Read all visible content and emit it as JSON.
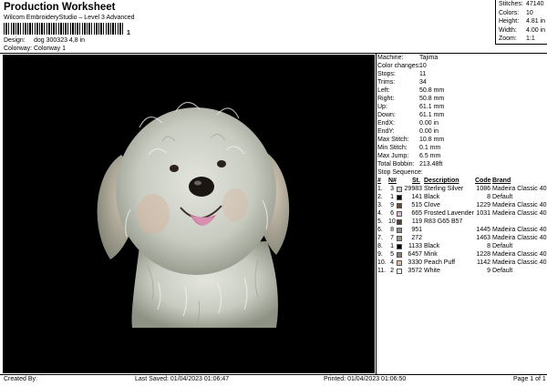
{
  "header": {
    "title": "Production Worksheet",
    "subtitle": "Wilcom EmbroideryStudio – Level 3 Advanced",
    "barcode_digit": "1",
    "design_label": "Design:",
    "design_value": "dog 300323 4,8 in",
    "colorway_label": "Colorway:",
    "colorway_value": "Colorway 1"
  },
  "stats": [
    {
      "label": "Stitches:",
      "value": "47140"
    },
    {
      "label": "Colors:",
      "value": "10"
    },
    {
      "label": "Height:",
      "value": "4.81 in"
    },
    {
      "label": "Width:",
      "value": "4.00 in"
    },
    {
      "label": "Zoom:",
      "value": "1:1"
    }
  ],
  "info": [
    {
      "label": "Machine:",
      "value": "Tajima"
    },
    {
      "label": "Color changes:",
      "value": "10"
    },
    {
      "label": "Stops:",
      "value": "11"
    },
    {
      "label": "Trims:",
      "value": "34"
    },
    {
      "label": "Left:",
      "value": "50.8 mm"
    },
    {
      "label": "Right:",
      "value": "50.8 mm"
    },
    {
      "label": "Up:",
      "value": "61.1 mm"
    },
    {
      "label": "Down:",
      "value": "61.1 mm"
    },
    {
      "label": "EndX:",
      "value": "0.00 in"
    },
    {
      "label": "EndY:",
      "value": "0.00 in"
    },
    {
      "label": "Max Stitch:",
      "value": "10.8 mm"
    },
    {
      "label": "Min Stitch:",
      "value": "0.1 mm"
    },
    {
      "label": "Max Jump:",
      "value": "6.5 mm"
    },
    {
      "label": "Total Bobbin:",
      "value": "213.48ft"
    }
  ],
  "stop_sequence_label": "Stop Sequence:",
  "table_headers": {
    "num": "#",
    "n": "N#",
    "st": "St.",
    "desc": "Description",
    "code": "Code",
    "brand": "Brand"
  },
  "stops": [
    {
      "num": "1.",
      "n": "3",
      "st": "29983",
      "desc": "Sterling Silver",
      "code": "1086",
      "brand": "Madeira Classic 40",
      "color": "#c9cbc4"
    },
    {
      "num": "2.",
      "n": "1",
      "st": "141",
      "desc": "Black",
      "code": "8",
      "brand": "Default",
      "color": "#000000"
    },
    {
      "num": "3.",
      "n": "9",
      "st": "515",
      "desc": "Clove",
      "code": "1229",
      "brand": "Madeira Classic 40",
      "color": "#6b4a3e"
    },
    {
      "num": "4.",
      "n": "6",
      "st": "665",
      "desc": "Frosted Lavender",
      "code": "1031",
      "brand": "Madeira Classic 40",
      "color": "#d9b8d6"
    },
    {
      "num": "5.",
      "n": "10",
      "st": "119",
      "desc": "R83 G65 B57",
      "code": "",
      "brand": "",
      "color": "#534139"
    },
    {
      "num": "6.",
      "n": "8",
      "st": "951",
      "desc": "",
      "code": "1445",
      "brand": "Madeira Classic 40",
      "color": "#8a8d84"
    },
    {
      "num": "7.",
      "n": "7",
      "st": "272",
      "desc": "",
      "code": "1463",
      "brand": "Madeira Classic 40",
      "color": "#9a9585"
    },
    {
      "num": "8.",
      "n": "1",
      "st": "1133",
      "desc": "Black",
      "code": "8",
      "brand": "Default",
      "color": "#000000"
    },
    {
      "num": "9.",
      "n": "5",
      "st": "6457",
      "desc": "Mink",
      "code": "1228",
      "brand": "Madeira Classic 40",
      "color": "#8c7a6b"
    },
    {
      "num": "10.",
      "n": "4",
      "st": "3330",
      "desc": "Peach Puff",
      "code": "1142",
      "brand": "Madeira Classic 40",
      "color": "#d8b8a4"
    },
    {
      "num": "11.",
      "n": "2",
      "st": "3572",
      "desc": "White",
      "code": "9",
      "brand": "Default",
      "color": "#ffffff"
    }
  ],
  "footer": {
    "created_by": "Created By:",
    "last_saved": "Last Saved: 01/04/2023 01:06:47",
    "printed": "Printed: 01/04/2023 01:06:50",
    "page": "Page 1 of 1"
  }
}
